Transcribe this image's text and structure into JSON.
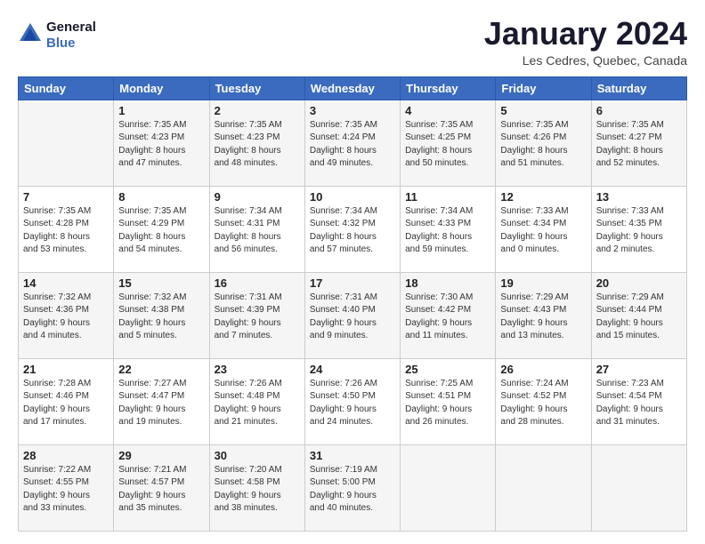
{
  "header": {
    "logo_line1": "General",
    "logo_line2": "Blue",
    "month": "January 2024",
    "location": "Les Cedres, Quebec, Canada"
  },
  "weekdays": [
    "Sunday",
    "Monday",
    "Tuesday",
    "Wednesday",
    "Thursday",
    "Friday",
    "Saturday"
  ],
  "weeks": [
    [
      {
        "day": "",
        "content": ""
      },
      {
        "day": "1",
        "content": "Sunrise: 7:35 AM\nSunset: 4:23 PM\nDaylight: 8 hours\nand 47 minutes."
      },
      {
        "day": "2",
        "content": "Sunrise: 7:35 AM\nSunset: 4:23 PM\nDaylight: 8 hours\nand 48 minutes."
      },
      {
        "day": "3",
        "content": "Sunrise: 7:35 AM\nSunset: 4:24 PM\nDaylight: 8 hours\nand 49 minutes."
      },
      {
        "day": "4",
        "content": "Sunrise: 7:35 AM\nSunset: 4:25 PM\nDaylight: 8 hours\nand 50 minutes."
      },
      {
        "day": "5",
        "content": "Sunrise: 7:35 AM\nSunset: 4:26 PM\nDaylight: 8 hours\nand 51 minutes."
      },
      {
        "day": "6",
        "content": "Sunrise: 7:35 AM\nSunset: 4:27 PM\nDaylight: 8 hours\nand 52 minutes."
      }
    ],
    [
      {
        "day": "7",
        "content": "Sunrise: 7:35 AM\nSunset: 4:28 PM\nDaylight: 8 hours\nand 53 minutes."
      },
      {
        "day": "8",
        "content": "Sunrise: 7:35 AM\nSunset: 4:29 PM\nDaylight: 8 hours\nand 54 minutes."
      },
      {
        "day": "9",
        "content": "Sunrise: 7:34 AM\nSunset: 4:31 PM\nDaylight: 8 hours\nand 56 minutes."
      },
      {
        "day": "10",
        "content": "Sunrise: 7:34 AM\nSunset: 4:32 PM\nDaylight: 8 hours\nand 57 minutes."
      },
      {
        "day": "11",
        "content": "Sunrise: 7:34 AM\nSunset: 4:33 PM\nDaylight: 8 hours\nand 59 minutes."
      },
      {
        "day": "12",
        "content": "Sunrise: 7:33 AM\nSunset: 4:34 PM\nDaylight: 9 hours\nand 0 minutes."
      },
      {
        "day": "13",
        "content": "Sunrise: 7:33 AM\nSunset: 4:35 PM\nDaylight: 9 hours\nand 2 minutes."
      }
    ],
    [
      {
        "day": "14",
        "content": "Sunrise: 7:32 AM\nSunset: 4:36 PM\nDaylight: 9 hours\nand 4 minutes."
      },
      {
        "day": "15",
        "content": "Sunrise: 7:32 AM\nSunset: 4:38 PM\nDaylight: 9 hours\nand 5 minutes."
      },
      {
        "day": "16",
        "content": "Sunrise: 7:31 AM\nSunset: 4:39 PM\nDaylight: 9 hours\nand 7 minutes."
      },
      {
        "day": "17",
        "content": "Sunrise: 7:31 AM\nSunset: 4:40 PM\nDaylight: 9 hours\nand 9 minutes."
      },
      {
        "day": "18",
        "content": "Sunrise: 7:30 AM\nSunset: 4:42 PM\nDaylight: 9 hours\nand 11 minutes."
      },
      {
        "day": "19",
        "content": "Sunrise: 7:29 AM\nSunset: 4:43 PM\nDaylight: 9 hours\nand 13 minutes."
      },
      {
        "day": "20",
        "content": "Sunrise: 7:29 AM\nSunset: 4:44 PM\nDaylight: 9 hours\nand 15 minutes."
      }
    ],
    [
      {
        "day": "21",
        "content": "Sunrise: 7:28 AM\nSunset: 4:46 PM\nDaylight: 9 hours\nand 17 minutes."
      },
      {
        "day": "22",
        "content": "Sunrise: 7:27 AM\nSunset: 4:47 PM\nDaylight: 9 hours\nand 19 minutes."
      },
      {
        "day": "23",
        "content": "Sunrise: 7:26 AM\nSunset: 4:48 PM\nDaylight: 9 hours\nand 21 minutes."
      },
      {
        "day": "24",
        "content": "Sunrise: 7:26 AM\nSunset: 4:50 PM\nDaylight: 9 hours\nand 24 minutes."
      },
      {
        "day": "25",
        "content": "Sunrise: 7:25 AM\nSunset: 4:51 PM\nDaylight: 9 hours\nand 26 minutes."
      },
      {
        "day": "26",
        "content": "Sunrise: 7:24 AM\nSunset: 4:52 PM\nDaylight: 9 hours\nand 28 minutes."
      },
      {
        "day": "27",
        "content": "Sunrise: 7:23 AM\nSunset: 4:54 PM\nDaylight: 9 hours\nand 31 minutes."
      }
    ],
    [
      {
        "day": "28",
        "content": "Sunrise: 7:22 AM\nSunset: 4:55 PM\nDaylight: 9 hours\nand 33 minutes."
      },
      {
        "day": "29",
        "content": "Sunrise: 7:21 AM\nSunset: 4:57 PM\nDaylight: 9 hours\nand 35 minutes."
      },
      {
        "day": "30",
        "content": "Sunrise: 7:20 AM\nSunset: 4:58 PM\nDaylight: 9 hours\nand 38 minutes."
      },
      {
        "day": "31",
        "content": "Sunrise: 7:19 AM\nSunset: 5:00 PM\nDaylight: 9 hours\nand 40 minutes."
      },
      {
        "day": "",
        "content": ""
      },
      {
        "day": "",
        "content": ""
      },
      {
        "day": "",
        "content": ""
      }
    ]
  ]
}
